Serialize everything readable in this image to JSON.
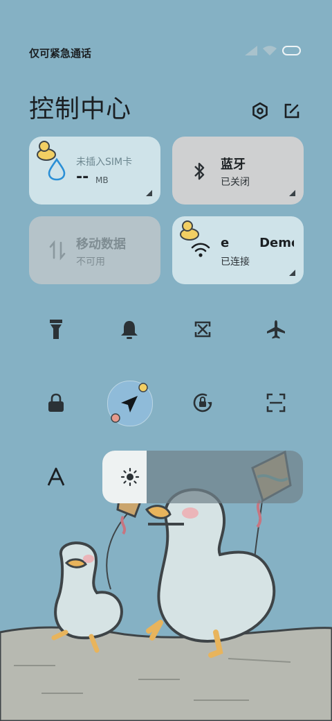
{
  "status": {
    "carrier": "仅可紧急通话"
  },
  "header": {
    "title": "控制中心"
  },
  "tiles": {
    "data_usage": {
      "title": "未插入SIM卡",
      "value": "--",
      "unit": "MB"
    },
    "bluetooth": {
      "title": "蓝牙",
      "status": "已关闭"
    },
    "mobile_data": {
      "title": "移动数据",
      "status": "不可用"
    },
    "wifi": {
      "title": "e       Demo",
      "status": "已连接"
    }
  },
  "toggles_row1": [
    "flashlight-icon",
    "bell-icon",
    "screenshot-icon",
    "airplane-icon"
  ],
  "toggles_row2": [
    "lock-icon",
    "location-icon",
    "rotation-lock-icon",
    "scanner-icon"
  ],
  "brightness": {
    "level": 0.22,
    "label_icon": "font-size-icon"
  },
  "colors": {
    "background": "#85b1c4",
    "tile_active": "#cfe3e9",
    "tile_off": "#cfd0d1",
    "accent_blue": "#2a8fd6"
  }
}
